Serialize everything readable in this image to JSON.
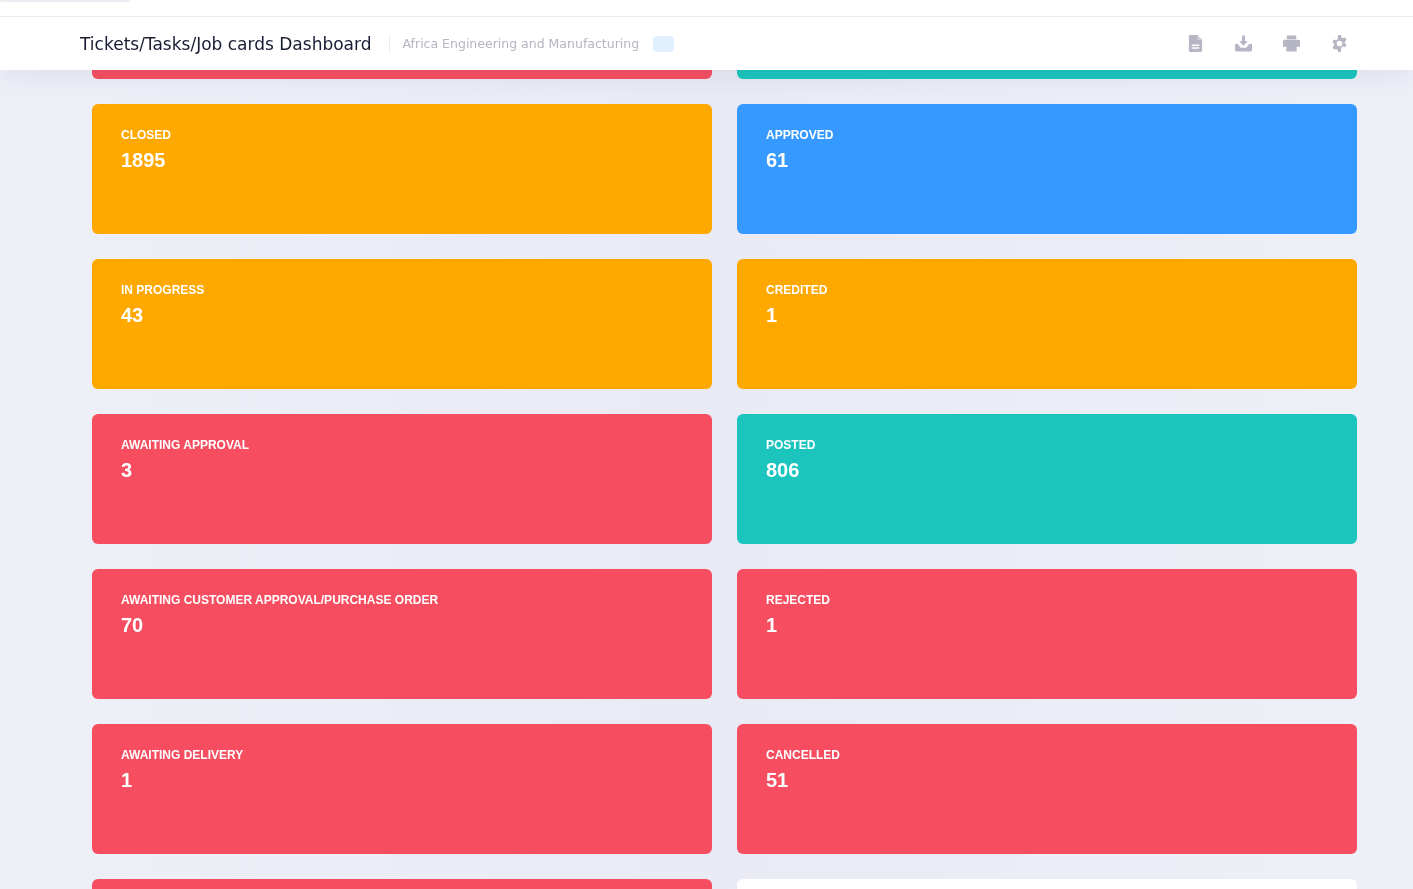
{
  "header": {
    "title": "Tickets/Tasks/Job cards Dashboard",
    "subtitle": "Africa Engineering and Manufacturing"
  },
  "cut_off_cards_top": [
    {
      "color": "#f64e60"
    },
    {
      "color": "#1bc5bd"
    }
  ],
  "status_cards": [
    {
      "label": "CLOSED",
      "count": "1895",
      "color": "#ffa800"
    },
    {
      "label": "APPROVED",
      "count": "61",
      "color": "#3699ff"
    },
    {
      "label": "IN PROGRESS",
      "count": "43",
      "color": "#ffa800"
    },
    {
      "label": "CREDITED",
      "count": "1",
      "color": "#ffa800"
    },
    {
      "label": "AWAITING APPROVAL",
      "count": "3",
      "color": "#f64e60"
    },
    {
      "label": "POSTED",
      "count": "806",
      "color": "#1bc5bd"
    },
    {
      "label": "AWAITING CUSTOMER APPROVAL/PURCHASE ORDER",
      "count": "70",
      "color": "#f64e60"
    },
    {
      "label": "REJECTED",
      "count": "1",
      "color": "#f64e60"
    },
    {
      "label": "AWAITING DELIVERY",
      "count": "1",
      "color": "#f64e60"
    },
    {
      "label": "CANCELLED",
      "count": "51",
      "color": "#f64e60"
    }
  ],
  "cut_off_cards_bottom": [
    {
      "color": "#f64e60"
    },
    {
      "color": "#ffffff"
    }
  ]
}
